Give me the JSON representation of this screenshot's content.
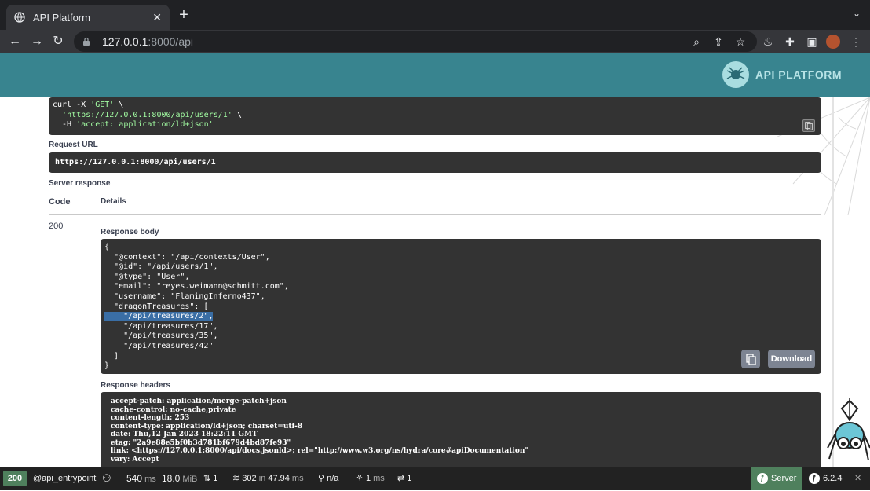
{
  "browser": {
    "tab_title": "API Platform",
    "tab_close": "✕",
    "new_tab": "+",
    "url_host": "127.0.0.1",
    "url_path": ":8000/api"
  },
  "header": {
    "logo_text": "API PLATFORM"
  },
  "curl": {
    "line1_a": "curl -X ",
    "line1_b": "'GET'",
    "line1_c": " \\",
    "line2_a": "  ",
    "line2_b": "'https://127.0.0.1:8000/api/users/1'",
    "line2_c": " \\",
    "line3_a": "  -H ",
    "line3_b": "'accept: application/ld+json'"
  },
  "request_url": {
    "label": "Request URL",
    "value": "https://127.0.0.1:8000/api/users/1"
  },
  "server_response": {
    "label": "Server response",
    "code_header": "Code",
    "details_header": "Details",
    "code": "200"
  },
  "response_body": {
    "label": "Response body",
    "lines": [
      "{",
      "  \"@context\": \"/api/contexts/User\",",
      "  \"@id\": \"/api/users/1\",",
      "  \"@type\": \"User\",",
      "  \"email\": \"reyes.weimann@schmitt.com\",",
      "  \"username\": \"FlamingInferno437\",",
      "  \"dragonTreasures\": [",
      "    \"/api/treasures/2\",",
      "    \"/api/treasures/17\",",
      "    \"/api/treasures/35\",",
      "    \"/api/treasures/42\"",
      "  ]",
      "}"
    ],
    "download_label": "Download"
  },
  "response_headers": {
    "label": "Response headers",
    "lines": [
      "accept-patch: application/merge-patch+json",
      "cache-control: no-cache,private",
      "content-length: 253",
      "content-type: application/ld+json; charset=utf-8",
      "date: Thu,12 Jan 2023 18:22:11 GMT",
      "etag: \"2a9e88e5bf0b3d781bf679d4bd87fe93\"",
      "link: <https://127.0.0.1:8000/api/docs.jsonld>; rel=\"http://www.w3.org/ns/hydra/core#apiDocumentation\"",
      "vary: Accept"
    ]
  },
  "statusbar": {
    "status": "200",
    "route": "@api_entrypoint",
    "time": "540",
    "time_unit": "ms",
    "memory": "18.0",
    "memory_unit": "MiB",
    "requests": "1",
    "cache": "302",
    "cache_in": "in",
    "cache_time": "47.94",
    "cache_unit": "ms",
    "user": "n/a",
    "twig": "1",
    "twig_unit": "ms",
    "http": "1",
    "server": "Server",
    "version": "6.2.4",
    "close": "✕"
  },
  "colors": {
    "header": "#38848f",
    "status_ok": "#4f805d",
    "code_bg": "#333333",
    "string": "#a2fca2"
  }
}
